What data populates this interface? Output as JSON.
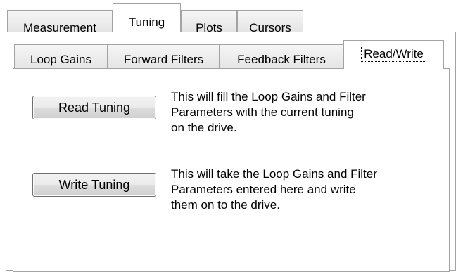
{
  "outer_tabs": [
    {
      "label": "Measurement"
    },
    {
      "label": "Tuning"
    },
    {
      "label": "Plots"
    },
    {
      "label": "Cursors"
    }
  ],
  "inner_tabs": [
    {
      "label": "Loop Gains"
    },
    {
      "label": "Forward Filters"
    },
    {
      "label": "Feedback Filters"
    },
    {
      "label": "Read/Write"
    }
  ],
  "read_section": {
    "button_label": "Read Tuning",
    "description_lines": [
      "This will fill the Loop Gains and Filter",
      "Parameters with the current tuning",
      "on the drive."
    ]
  },
  "write_section": {
    "button_label": "Write Tuning",
    "description_lines": [
      "This will take the Loop Gains and Filter",
      "Parameters entered here and write",
      "them on to the drive."
    ]
  }
}
